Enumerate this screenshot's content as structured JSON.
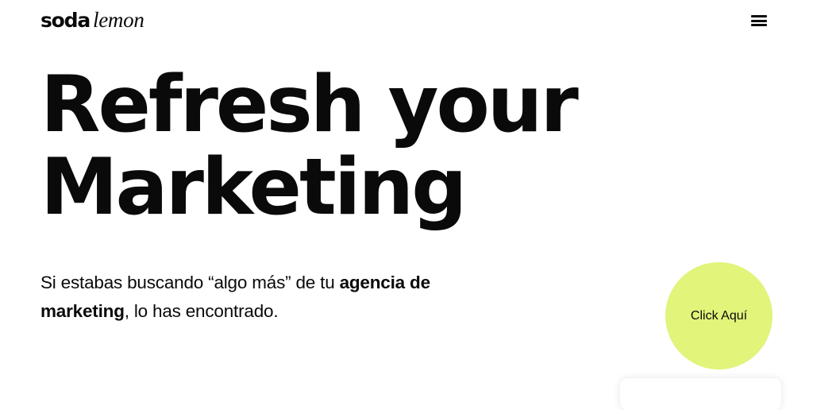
{
  "header": {
    "logo": {
      "bold": "soda",
      "italic": "lemon"
    },
    "menu_icon": "hamburger-menu-icon"
  },
  "hero": {
    "title_line1": "Refresh your",
    "title_line2": "Marketing"
  },
  "subtitle": {
    "part1": "Si estabas buscando “algo más” de tu ",
    "bold1": "agencia de marketing",
    "part2": ", lo has encontrado."
  },
  "cta": {
    "label": "Click Aquí",
    "color": "#e2f47a"
  },
  "colors": {
    "text": "#0a0a0a",
    "background": "#ffffff",
    "accent": "#e2f47a"
  }
}
